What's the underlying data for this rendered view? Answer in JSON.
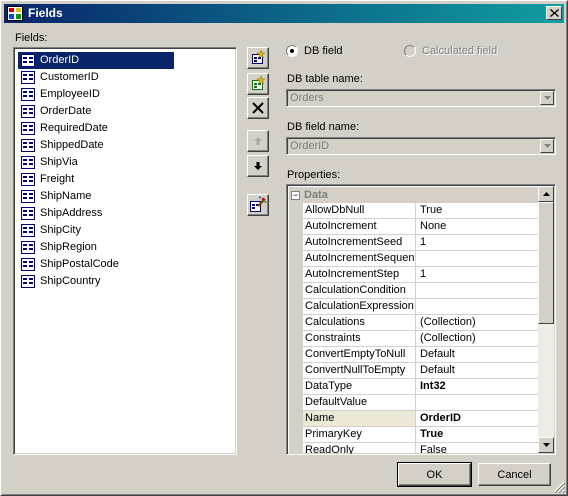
{
  "window": {
    "title": "Fields"
  },
  "fields_panel": {
    "label": "Fields:",
    "items": [
      {
        "name": "OrderID",
        "selected": true
      },
      {
        "name": "CustomerID"
      },
      {
        "name": "EmployeeID"
      },
      {
        "name": "OrderDate"
      },
      {
        "name": "RequiredDate"
      },
      {
        "name": "ShippedDate"
      },
      {
        "name": "ShipVia"
      },
      {
        "name": "Freight"
      },
      {
        "name": "ShipName"
      },
      {
        "name": "ShipAddress"
      },
      {
        "name": "ShipCity"
      },
      {
        "name": "ShipRegion"
      },
      {
        "name": "ShipPostalCode"
      },
      {
        "name": "ShipCountry"
      }
    ]
  },
  "toolbar": {
    "icons": [
      "add-field-icon",
      "add-calculated-field-icon",
      "delete-icon",
      "move-up-icon",
      "move-down-icon",
      "field-wizard-icon"
    ]
  },
  "source": {
    "db_field_label": "DB field",
    "calculated_field_label": "Calculated field",
    "selected": "DB field"
  },
  "db_table": {
    "label": "DB table name:",
    "value": "Orders"
  },
  "db_field": {
    "label": "DB field name:",
    "value": "OrderID"
  },
  "properties": {
    "label": "Properties:",
    "category": "Data",
    "rows": [
      {
        "name": "AllowDbNull",
        "value": "True"
      },
      {
        "name": "AutoIncrement",
        "value": "None"
      },
      {
        "name": "AutoIncrementSeed",
        "value": "1"
      },
      {
        "name": "AutoIncrementSequence",
        "value": ""
      },
      {
        "name": "AutoIncrementStep",
        "value": "1"
      },
      {
        "name": "CalculationCondition",
        "value": ""
      },
      {
        "name": "CalculationExpression",
        "value": ""
      },
      {
        "name": "Calculations",
        "value": "(Collection)"
      },
      {
        "name": "Constraints",
        "value": "(Collection)"
      },
      {
        "name": "ConvertEmptyToNull",
        "value": "Default"
      },
      {
        "name": "ConvertNullToEmpty",
        "value": "Default"
      },
      {
        "name": "DataType",
        "value": "Int32",
        "bold": true
      },
      {
        "name": "DefaultValue",
        "value": ""
      },
      {
        "name": "Name",
        "value": "OrderID",
        "bold": true,
        "selected": true
      },
      {
        "name": "PrimaryKey",
        "value": "True",
        "bold": true
      },
      {
        "name": "ReadOnly",
        "value": "False"
      }
    ]
  },
  "buttons": {
    "ok": "OK",
    "cancel": "Cancel"
  },
  "colors": {
    "selection": "#0a246a",
    "titlebar_start": "#0a246a",
    "titlebar_end": "#109da0",
    "face": "#d4d0c8"
  }
}
